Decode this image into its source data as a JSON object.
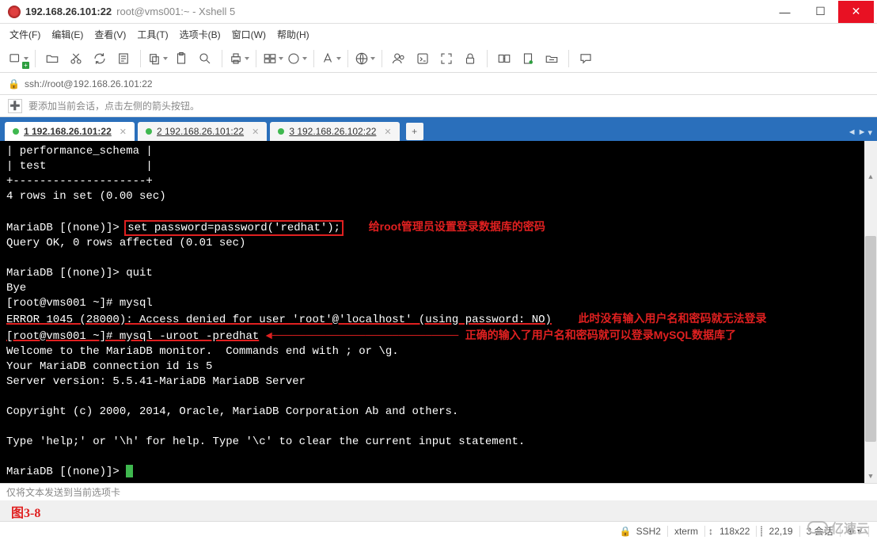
{
  "window": {
    "title_strong": "192.168.26.101:22",
    "title_rest": "root@vms001:~ - Xshell 5"
  },
  "menus": [
    "文件(F)",
    "编辑(E)",
    "查看(V)",
    "工具(T)",
    "选项卡(B)",
    "窗口(W)",
    "帮助(H)"
  ],
  "address": "ssh://root@192.168.26.101:22",
  "hint": "要添加当前会话，点击左侧的箭头按钮。",
  "tabs": [
    {
      "label": "1 192.168.26.101:22",
      "active": true
    },
    {
      "label": "2 192.168.26.101:22",
      "active": false
    },
    {
      "label": "3 192.168.26.102:22",
      "active": false
    }
  ],
  "terminal": {
    "lines": [
      "| performance_schema |",
      "| test               |",
      "+--------------------+",
      "4 rows in set (0.00 sec)",
      "",
      "MariaDB [(none)]> ",
      "set password=password('redhat');",
      "给root管理员设置登录数据库的密码",
      "Query OK, 0 rows affected (0.01 sec)",
      "",
      "MariaDB [(none)]> quit",
      "Bye",
      "[root@vms001 ~]# mysql",
      "ERROR 1045 (28000): Access denied for user 'root'@'localhost' (using password: NO)",
      "此时没有输入用户名和密码就无法登录",
      "[root@vms001 ~]# mysql -uroot -predhat",
      "正确的输入了用户名和密码就可以登录MySQL数据库了",
      "Welcome to the MariaDB monitor.  Commands end with ; or \\g.",
      "Your MariaDB connection id is 5",
      "Server version: 5.5.41-MariaDB MariaDB Server",
      "",
      "Copyright (c) 2000, 2014, Oracle, MariaDB Corporation Ab and others.",
      "",
      "Type 'help;' or '\\h' for help. Type '\\c' to clear the current input statement.",
      "",
      "MariaDB [(none)]> "
    ]
  },
  "input_hint": "仅将文本发送到当前选项卡",
  "caption": "图3-8",
  "status": {
    "conn": "SSH2",
    "term": "xterm",
    "size": "118x22",
    "pos": "22,19",
    "sessions": "3 会话"
  },
  "watermark": "亿速云"
}
